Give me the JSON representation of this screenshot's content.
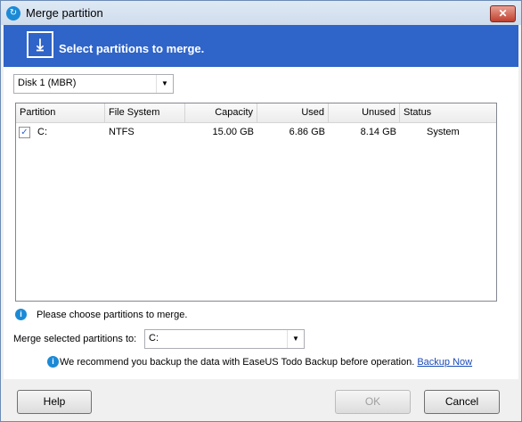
{
  "window": {
    "title": "Merge partition",
    "close_glyph": "✕"
  },
  "banner": {
    "text": "Select partitions to merge."
  },
  "disk_select": {
    "value": "Disk 1 (MBR)"
  },
  "table": {
    "columns": [
      "Partition",
      "File System",
      "Capacity",
      "Used",
      "Unused",
      "Status"
    ],
    "rows": [
      {
        "checked": true,
        "partition": "C:",
        "file_system": "NTFS",
        "capacity": "15.00 GB",
        "used": "6.86 GB",
        "unused": "8.14 GB",
        "status": "System"
      }
    ]
  },
  "hint": "Please choose partitions to merge.",
  "merge_to": {
    "label": "Merge selected partitions to:",
    "value": "C:"
  },
  "recommend": {
    "text": "We recommend you backup the data with EaseUS Todo Backup before operation.",
    "link": "Backup Now"
  },
  "buttons": {
    "help": "Help",
    "ok": "OK",
    "cancel": "Cancel"
  },
  "icons": {
    "app": "easeus-partition-icon",
    "merge": "merge-icon",
    "info": "info-icon",
    "dropdown": "chevron-down-icon",
    "check": "checkmark-icon"
  }
}
